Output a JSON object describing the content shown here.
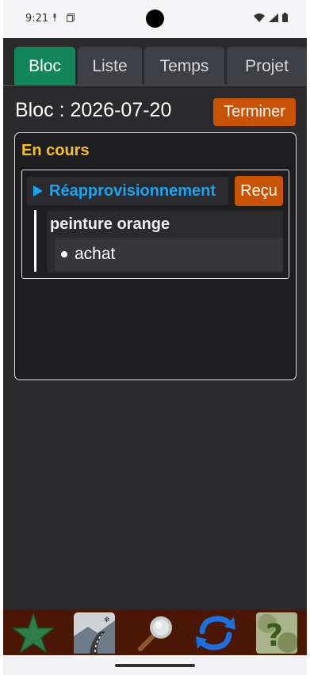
{
  "status_bar": {
    "time": "9:21",
    "icons": [
      "mic-icon",
      "copy-icon",
      "wifi-icon",
      "signal-icon",
      "battery-icon"
    ]
  },
  "tabs": [
    {
      "label": "Bloc",
      "active": true
    },
    {
      "label": "Liste",
      "active": false
    },
    {
      "label": "Temps",
      "active": false
    },
    {
      "label": "Projet",
      "active": false
    }
  ],
  "header": {
    "title": "Bloc : 2026-07-20",
    "finish_label": "Terminer"
  },
  "card": {
    "title": "En cours",
    "group": {
      "name": "Réapprovisionnement",
      "received_label": "Reçu",
      "item": {
        "title": "peinture orange",
        "subitems": [
          "achat"
        ]
      }
    }
  },
  "toolbar": {
    "icons": [
      "star-icon",
      "road-icon",
      "magnifier-icon",
      "refresh-icon",
      "help-icon"
    ]
  },
  "colors": {
    "accent_green": "#14845a",
    "action_orange": "#c85304",
    "heading_yellow": "#f6bf26",
    "link_blue": "#1aa3ef",
    "toolbar_brown": "#4a1705"
  }
}
